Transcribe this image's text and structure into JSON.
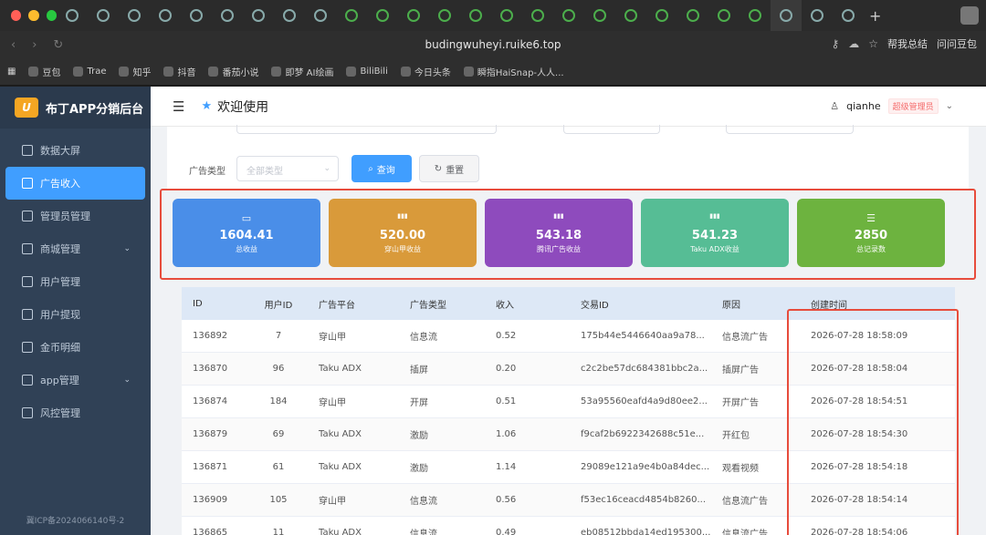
{
  "browser": {
    "url": "budingwuheyi.ruike6.top",
    "actions": [
      "帮我总结",
      "问问豆包"
    ],
    "bookmarks": [
      "豆包",
      "Trae",
      "知乎",
      "抖音",
      "番茄小说",
      "即梦 AI绘画",
      "BiliBili",
      "今日头条",
      "瞬指HaiSnap-人人..."
    ]
  },
  "sidebar": {
    "logo_mark": "U",
    "title": "布丁APP分销后台",
    "items": [
      {
        "label": "数据大屏",
        "icon": "dashboard-icon"
      },
      {
        "label": "广告收入",
        "icon": "ad-icon",
        "active": true
      },
      {
        "label": "管理员管理",
        "icon": "admin-icon"
      },
      {
        "label": "商城管理",
        "icon": "cart-icon",
        "expandable": true
      },
      {
        "label": "用户管理",
        "icon": "user-icon"
      },
      {
        "label": "用户提现",
        "icon": "withdraw-icon"
      },
      {
        "label": "金币明细",
        "icon": "coin-icon"
      },
      {
        "label": "app管理",
        "icon": "gear-icon",
        "expandable": true
      },
      {
        "label": "风控管理",
        "icon": "shield-icon"
      }
    ],
    "icp": "冀ICP备2024066140号-2"
  },
  "header": {
    "welcome": "欢迎使用",
    "username": "qianhe",
    "role": "超级管理员"
  },
  "filters": {
    "ad_type_label": "广告类型",
    "ad_type_placeholder": "全部类型",
    "query_label": "查询",
    "reset_label": "重置"
  },
  "stats": [
    {
      "value": "1604.41",
      "label": "总收益",
      "color": "#4a8ee8"
    },
    {
      "value": "520.00",
      "label": "穿山甲收益",
      "color": "#d99a3a"
    },
    {
      "value": "543.18",
      "label": "腾讯广告收益",
      "color": "#8e4bbd"
    },
    {
      "value": "541.23",
      "label": "Taku ADX收益",
      "color": "#56bd95"
    },
    {
      "value": "2850",
      "label": "总记录数",
      "color": "#6db33f"
    }
  ],
  "table": {
    "columns": [
      "ID",
      "用户ID",
      "广告平台",
      "广告类型",
      "收入",
      "交易ID",
      "原因",
      "创建时间"
    ],
    "rows": [
      [
        "136892",
        "7",
        "穿山甲",
        "信息流",
        "0.52",
        "175b44e5446640aa9a78...",
        "信息流广告",
        "2026-07-28 18:58:09"
      ],
      [
        "136870",
        "96",
        "Taku ADX",
        "插屏",
        "0.20",
        "c2c2be57dc684381bbc2a...",
        "插屏广告",
        "2026-07-28 18:58:04"
      ],
      [
        "136874",
        "184",
        "穿山甲",
        "开屏",
        "0.51",
        "53a95560eafd4a9d80ee2...",
        "开屏广告",
        "2026-07-28 18:54:51"
      ],
      [
        "136879",
        "69",
        "Taku ADX",
        "激励",
        "1.06",
        "f9caf2b6922342688c51e...",
        "开红包",
        "2026-07-28 18:54:30"
      ],
      [
        "136871",
        "61",
        "Taku ADX",
        "激励",
        "1.14",
        "29089e121a9e4b0a84dec...",
        "观看视频",
        "2026-07-28 18:54:18"
      ],
      [
        "136909",
        "105",
        "穿山甲",
        "信息流",
        "0.56",
        "f53ec16ceacd4854b8260...",
        "信息流广告",
        "2026-07-28 18:54:14"
      ],
      [
        "136865",
        "11",
        "Taku ADX",
        "信息流",
        "0.49",
        "eb08512bbda14ed195300...",
        "信息流广告",
        "2026-07-28 18:54:06"
      ]
    ]
  }
}
